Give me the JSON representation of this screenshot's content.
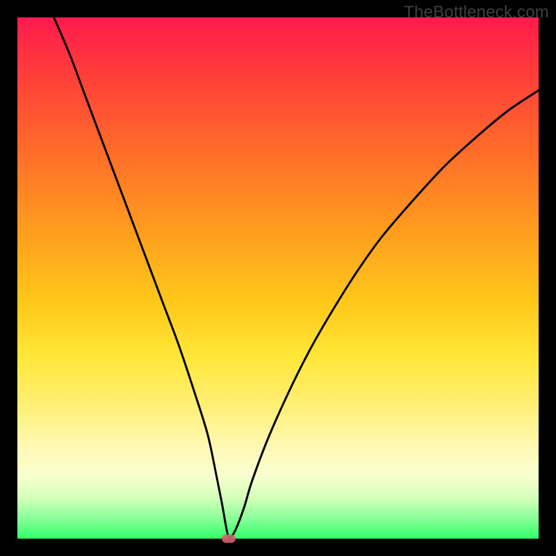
{
  "watermark": "TheBottleneck.com",
  "colors": {
    "frame": "#000000",
    "curve": "#000000",
    "marker": "#d1646b"
  },
  "chart_data": {
    "type": "line",
    "title": "",
    "xlabel": "",
    "ylabel": "",
    "xlim": [
      0,
      100
    ],
    "ylim": [
      0,
      100
    ],
    "optimal": {
      "x": 40.5,
      "y": 0
    },
    "series": [
      {
        "name": "bottleneck-curve",
        "x": [
          7,
          10,
          13,
          16,
          19,
          22,
          25,
          28,
          31,
          34,
          36.5,
          38,
          39.2,
          40,
          40.5,
          41,
          42,
          43.5,
          45,
          48,
          52,
          56,
          60,
          65,
          70,
          76,
          82,
          88,
          94,
          100
        ],
        "y": [
          100,
          93,
          85,
          77,
          69,
          61,
          53,
          45,
          37,
          28,
          20,
          13,
          7,
          2.5,
          0.3,
          0.3,
          2,
          6,
          11,
          19,
          28,
          36,
          43,
          51,
          58,
          65,
          71.5,
          77,
          82,
          86
        ]
      }
    ]
  }
}
